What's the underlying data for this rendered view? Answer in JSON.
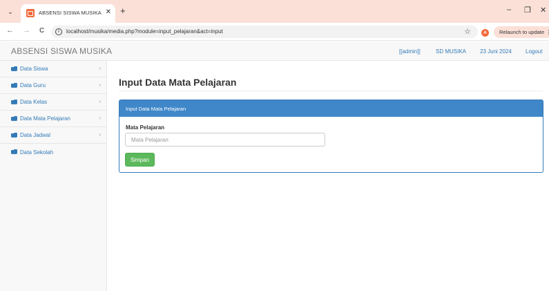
{
  "browser": {
    "tab_title": "ABSENSI SISWA MUSIKA",
    "url": "localhost/musika/media.php?module=input_pelajaran&act=input",
    "profile_initial": "A",
    "relaunch_label": "Relaunch to update",
    "icons": {
      "tab_menu": "chevron-down-icon",
      "close": "close-icon",
      "new_tab": "plus-icon",
      "back": "arrow-left-icon",
      "forward": "arrow-right-icon",
      "reload": "reload-icon",
      "info": "info-icon",
      "bookmark": "star-icon",
      "minimize": "minimize-icon",
      "restore": "restore-icon"
    },
    "glyphs": {
      "tab_menu": "⌄",
      "tab_close": "✕",
      "new_tab": "+",
      "back": "←",
      "forward": "→",
      "reload": "C",
      "info": "i",
      "star": "☆",
      "minimize": "–",
      "restore": "❐",
      "window_close": "✕",
      "kebab": "⋮"
    }
  },
  "header": {
    "brand": "ABSENSI SISWA MUSIKA",
    "user": "[[admin]]",
    "school": "SD MUSIKA",
    "date": "23 Juni 2024",
    "logout": "Logout"
  },
  "sidebar": {
    "chevron": "‹",
    "items": [
      {
        "label": "Data Siswa",
        "has_chevron": true
      },
      {
        "label": "Data Guru",
        "has_chevron": true
      },
      {
        "label": "Data Kelas",
        "has_chevron": true
      },
      {
        "label": "Data Mata Pelajaran",
        "has_chevron": true
      },
      {
        "label": "Data Jadwal",
        "has_chevron": true
      },
      {
        "label": "Data Sekolah",
        "has_chevron": false
      }
    ]
  },
  "main": {
    "title": "Input Data Mata Pelajaran",
    "panel_heading": "Input Data Mata Pelajaran",
    "field_label": "Mata Pelajaran",
    "field_placeholder": "Mata Pelajaran",
    "field_value": "",
    "submit_label": "Simpan"
  },
  "colors": {
    "tabbar": "#fbe0d8",
    "link": "#337ab7",
    "panel_heading": "#3f87c9",
    "button_success": "#5cb85c",
    "favicon": "#f06a3a"
  }
}
